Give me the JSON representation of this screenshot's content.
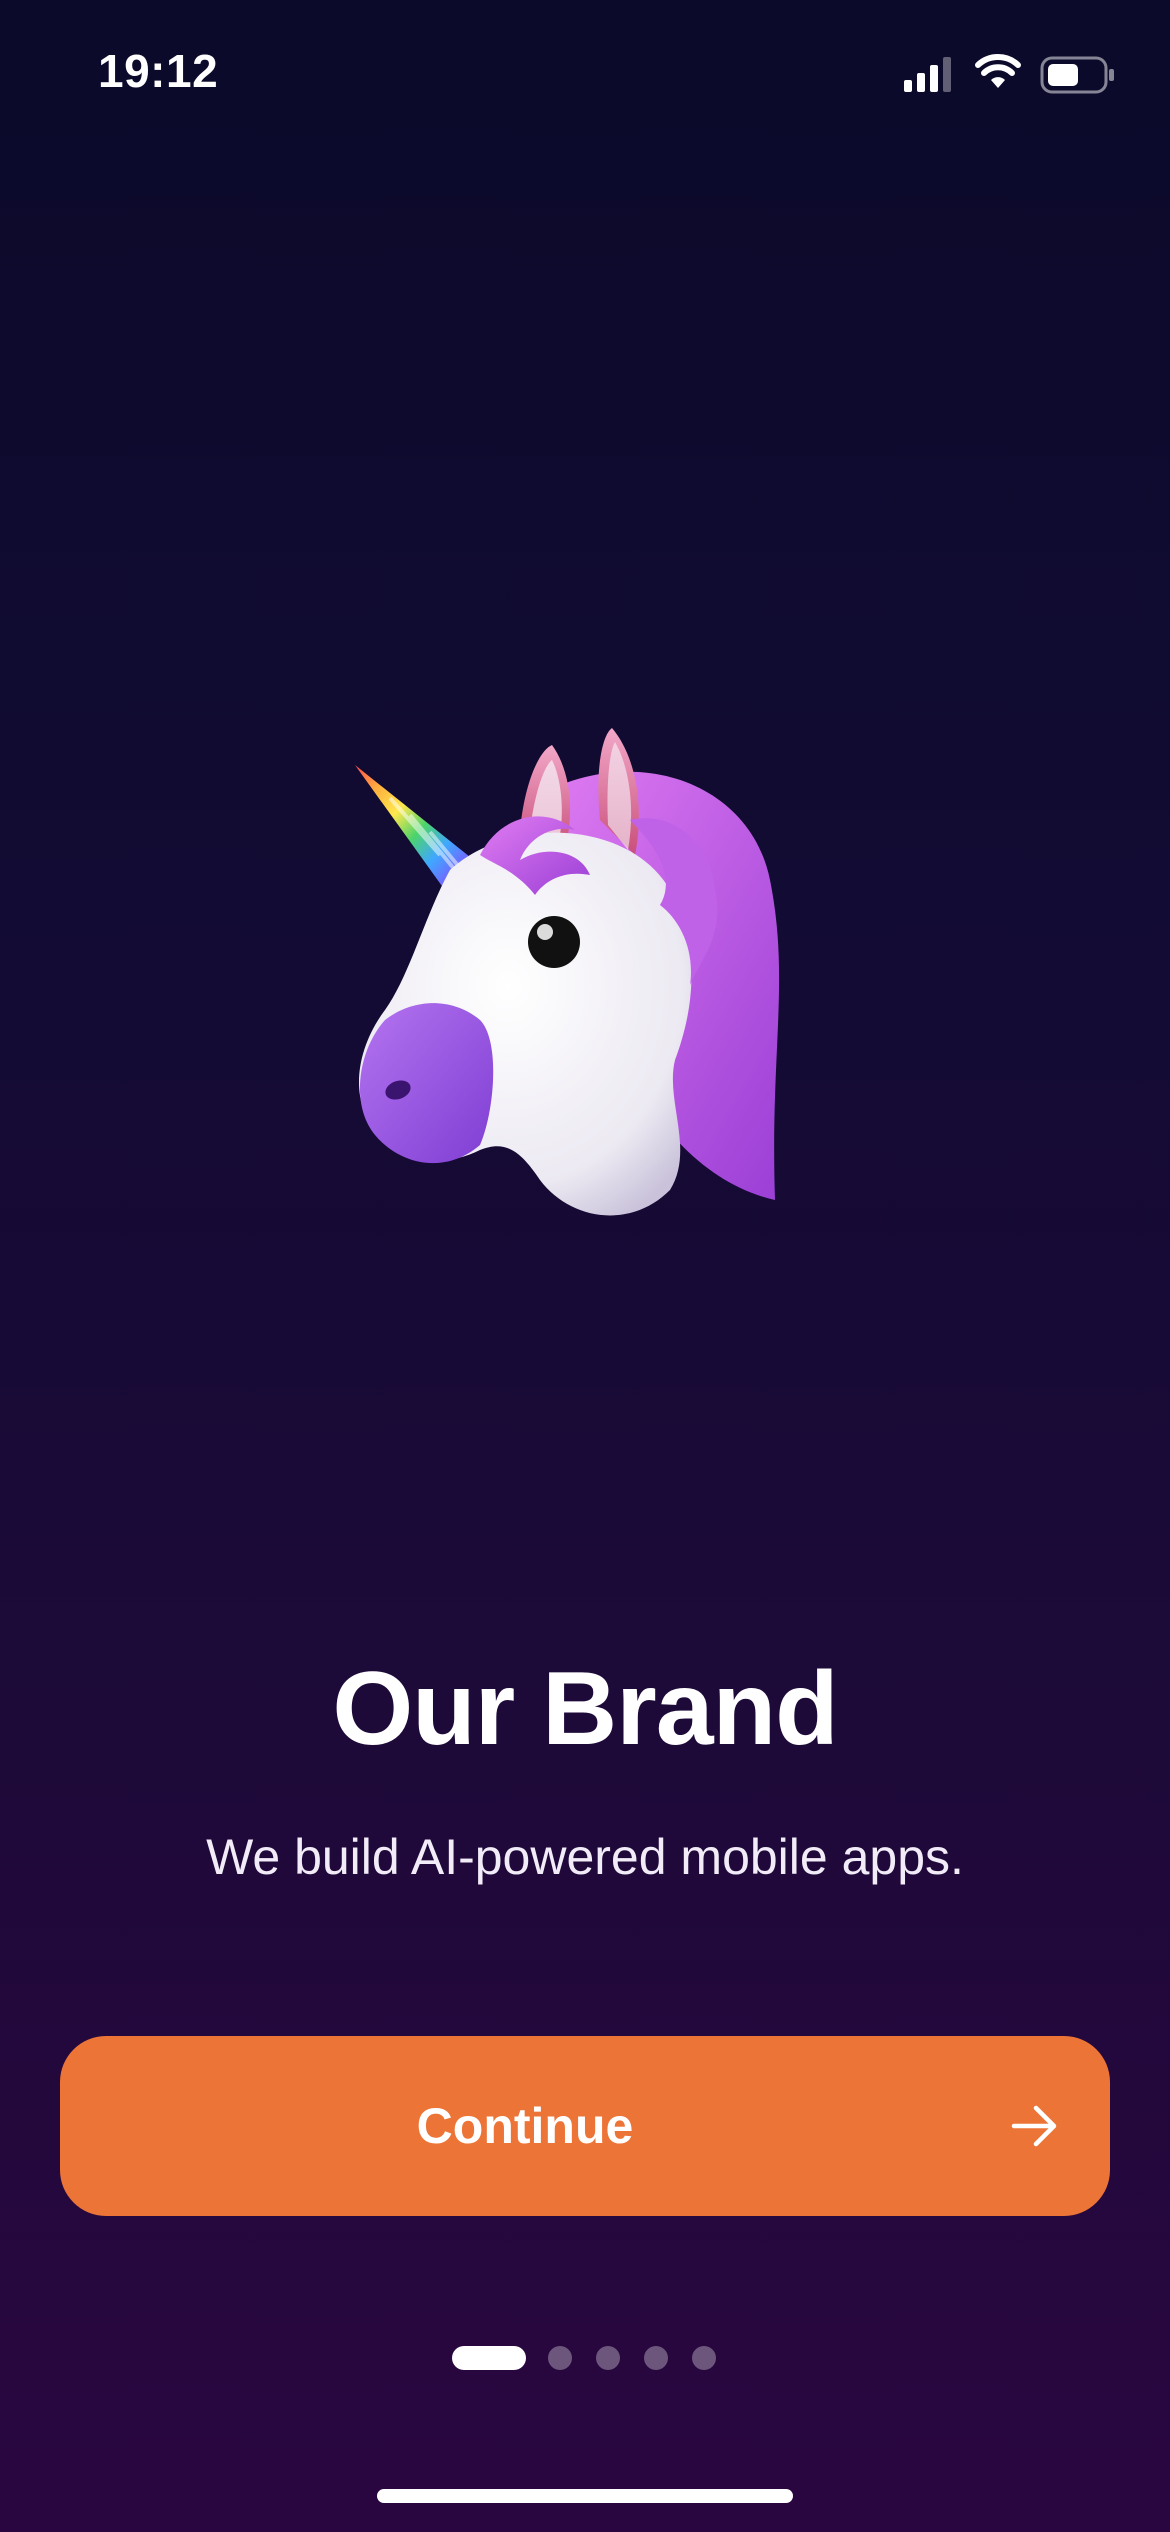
{
  "status_bar": {
    "time": "19:12",
    "signal_icon": "cellular-signal-icon",
    "wifi_icon": "wifi-icon",
    "battery_icon": "battery-icon"
  },
  "hero": {
    "image": "unicorn-emoji-illustration"
  },
  "onboarding": {
    "title": "Our Brand",
    "subtitle": "We build AI-powered mobile apps."
  },
  "continue_button": {
    "label": "Continue",
    "icon": "arrow-right-icon",
    "color": "#ec7436"
  },
  "pagination": {
    "total_pages": 5,
    "current_page": 1
  },
  "colors": {
    "background_top": "#0b0a2a",
    "background_bottom": "#2a0640",
    "accent": "#ec7436"
  }
}
